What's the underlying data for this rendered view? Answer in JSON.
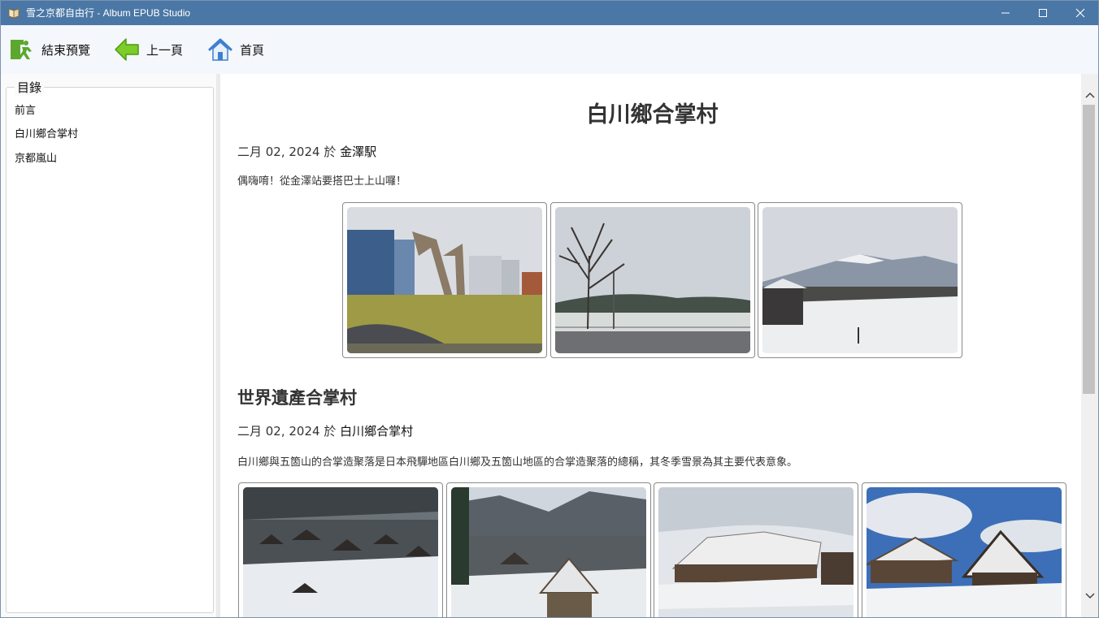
{
  "window": {
    "title": "雪之京都自由行 - Album EPUB Studio"
  },
  "toolbar": {
    "exit_label": "結束預覽",
    "prev_label": "上一頁",
    "home_label": "首頁"
  },
  "toc": {
    "title": "目錄",
    "items": [
      {
        "label": "前言"
      },
      {
        "label": "白川鄉合掌村"
      },
      {
        "label": "京都嵐山"
      }
    ]
  },
  "page": {
    "title": "白川鄉合掌村",
    "entry1": {
      "date": "二月 02, 2024",
      "at": "於",
      "place": "金澤駅",
      "text": "偶嗨唷！從金澤站要搭巴士上山囉！"
    },
    "section2": {
      "title": "世界遺產合掌村",
      "date": "二月 02, 2024",
      "at": "於",
      "place": "白川鄉合掌村",
      "text": "白川鄉與五箇山的合掌造聚落是日本飛驒地區白川鄉及五箇山地區的合掌造聚落的總稱，其冬季雪景為其主要代表意象。"
    }
  },
  "colors": {
    "titlebar": "#4a77a5",
    "toolbar": "#f4f7fc",
    "exit_icon": "#5ca82e",
    "prev_icon": "#7ccc2a",
    "home_icon": "#3d7fd0"
  },
  "icons": {
    "app": "book-icon",
    "exit": "exit-icon",
    "prev": "arrow-left-icon",
    "home": "home-icon"
  }
}
